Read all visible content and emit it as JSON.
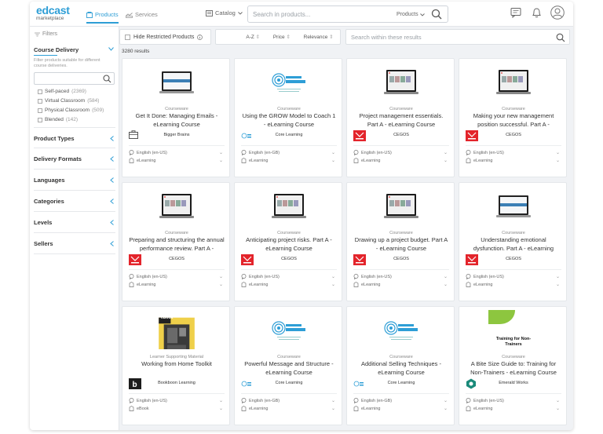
{
  "header": {
    "logo_text": "edcast",
    "logo_sub": "marketplace",
    "tabs": [
      {
        "label": "Products"
      },
      {
        "label": "Services"
      }
    ],
    "catalog_label": "Catalog",
    "search_placeholder": "Search in products...",
    "search_scope": "Products",
    "accent_color": "#2e9ed6"
  },
  "sidebar": {
    "filters_label": "Filters",
    "course_delivery": {
      "label": "Course Delivery",
      "description": "Filter products suitable for different course deliveries.",
      "options": [
        {
          "label": "Self-paced",
          "count": "(2369)"
        },
        {
          "label": "Virtual Classroom",
          "count": "(584)"
        },
        {
          "label": "Physical Classroom",
          "count": "(509)"
        },
        {
          "label": "Blended",
          "count": "(142)"
        }
      ]
    },
    "sections": [
      {
        "label": "Product Types"
      },
      {
        "label": "Delivery Formats"
      },
      {
        "label": "Languages"
      },
      {
        "label": "Categories"
      },
      {
        "label": "Levels"
      },
      {
        "label": "Sellers"
      }
    ]
  },
  "toolbar": {
    "hide_restricted": "Hide Restricted Products",
    "sorts": [
      "A-Z",
      "Price",
      "Relevance"
    ],
    "within_placeholder": "Search within these results"
  },
  "results_count": "3280 results",
  "cards": [
    {
      "type": "Courseware",
      "title": "Get It Done: Managing Emails - eLearning Course",
      "seller": "Bigger Brains",
      "lang": "English (en-US)",
      "format": "eLearning",
      "thumb": "laptop-blue",
      "logo": "briefcase"
    },
    {
      "type": "Courseware",
      "title": "Using the GROW Model to Coach 1 - eLearning Course",
      "seller": "Core Learning",
      "lang": "English (en-GB)",
      "format": "eLearning",
      "thumb": "core",
      "logo": "core"
    },
    {
      "type": "Courseware",
      "title": "Project management essentials. Part A - eLearning Course",
      "seller": "CEGOS",
      "lang": "English (en-US)",
      "format": "eLearning",
      "thumb": "laptop-dark",
      "logo": "cegos"
    },
    {
      "type": "Courseware",
      "title": "Making your new management position successful. Part A - eLearning Course",
      "seller": "CEGOS",
      "lang": "English (en-US)",
      "format": "eLearning",
      "thumb": "laptop-dark",
      "logo": "cegos"
    },
    {
      "type": "Courseware",
      "title": "Preparing and structuring the annual performance review. Part A - eLearning Course",
      "seller": "CEGOS",
      "lang": "English (en-US)",
      "format": "eLearning",
      "thumb": "laptop-dark",
      "logo": "cegos"
    },
    {
      "type": "Courseware",
      "title": "Anticipating project risks. Part A - eLearning Course",
      "seller": "CEGOS",
      "lang": "English (en-US)",
      "format": "eLearning",
      "thumb": "laptop-dark",
      "logo": "cegos"
    },
    {
      "type": "Courseware",
      "title": "Drawing up a project budget. Part A - eLearning Course",
      "seller": "CEGOS",
      "lang": "English (en-US)",
      "format": "eLearning",
      "thumb": "laptop-dark",
      "logo": "cegos"
    },
    {
      "type": "Courseware",
      "title": "Understanding emotional dysfunction. Part A - eLearning Course",
      "seller": "CEGOS",
      "lang": "English (en-US)",
      "format": "eLearning",
      "thumb": "laptop-blue",
      "logo": "cegos"
    },
    {
      "type": "Learner Supporting Material",
      "title": "Working from Home Toolkit",
      "seller": "Bookboon Learning",
      "lang": "English (en-US)",
      "format": "eBook",
      "thumb": "ebook",
      "logo": "bookboon",
      "badge": "eBook"
    },
    {
      "type": "Courseware",
      "title": "Powerful Message and Structure - eLearning Course",
      "seller": "Core Learning",
      "lang": "English (en-GB)",
      "format": "eLearning",
      "thumb": "core",
      "logo": "core"
    },
    {
      "type": "Courseware",
      "title": "Additional Selling Techniques - eLearning Course",
      "seller": "Core Learning",
      "lang": "English (en-GB)",
      "format": "eLearning",
      "thumb": "core",
      "logo": "core"
    },
    {
      "type": "Courseware",
      "title": "A Bite Size Guide to: Training for Non-Trainers - eLearning Course",
      "seller": "Emerald Works",
      "lang": "English (en-US)",
      "format": "eLearning",
      "thumb": "training",
      "logo": "emerald",
      "thumb_text": "Training for Non-Trainers"
    }
  ]
}
